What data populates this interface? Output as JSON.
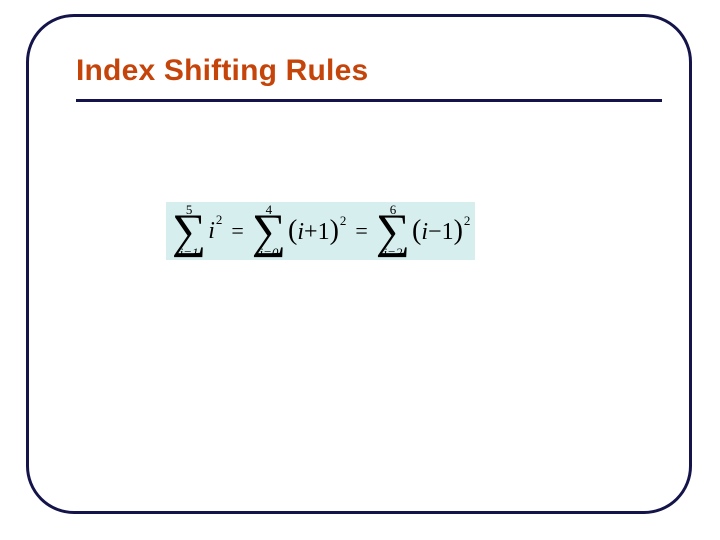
{
  "title": "Index Shifting Rules",
  "formula": {
    "sum1": {
      "upper": "5",
      "lower": "i=1",
      "base": "i",
      "exp": "2"
    },
    "eq1": "=",
    "sum2": {
      "upper": "4",
      "lower": "i=0",
      "lparen": "(",
      "inner_var": "i",
      "inner_op": "+",
      "inner_num": "1",
      "rparen": ")",
      "exp": "2"
    },
    "eq2": "=",
    "sum3": {
      "upper": "6",
      "lower": "i=2",
      "lparen": "(",
      "inner_var": "i",
      "inner_op": "−",
      "inner_num": "1",
      "rparen": ")",
      "exp": "2"
    }
  }
}
